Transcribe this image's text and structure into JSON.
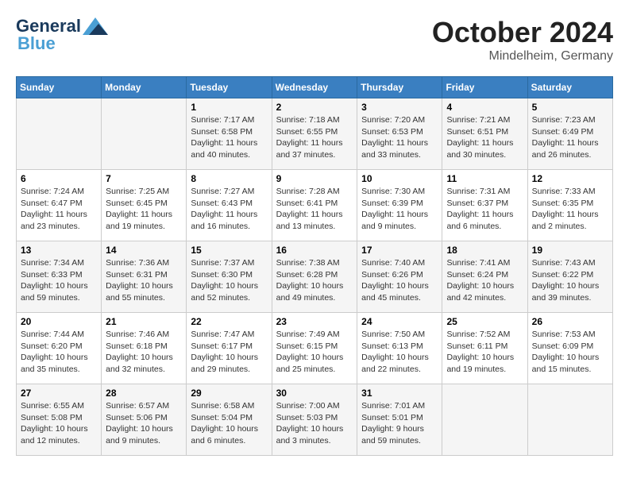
{
  "header": {
    "logo_line1": "General",
    "logo_line2": "Blue",
    "month": "October 2024",
    "location": "Mindelheim, Germany"
  },
  "days_of_week": [
    "Sunday",
    "Monday",
    "Tuesday",
    "Wednesday",
    "Thursday",
    "Friday",
    "Saturday"
  ],
  "weeks": [
    [
      {
        "day": "",
        "sunrise": "",
        "sunset": "",
        "daylight": ""
      },
      {
        "day": "",
        "sunrise": "",
        "sunset": "",
        "daylight": ""
      },
      {
        "day": "1",
        "sunrise": "Sunrise: 7:17 AM",
        "sunset": "Sunset: 6:58 PM",
        "daylight": "Daylight: 11 hours and 40 minutes."
      },
      {
        "day": "2",
        "sunrise": "Sunrise: 7:18 AM",
        "sunset": "Sunset: 6:55 PM",
        "daylight": "Daylight: 11 hours and 37 minutes."
      },
      {
        "day": "3",
        "sunrise": "Sunrise: 7:20 AM",
        "sunset": "Sunset: 6:53 PM",
        "daylight": "Daylight: 11 hours and 33 minutes."
      },
      {
        "day": "4",
        "sunrise": "Sunrise: 7:21 AM",
        "sunset": "Sunset: 6:51 PM",
        "daylight": "Daylight: 11 hours and 30 minutes."
      },
      {
        "day": "5",
        "sunrise": "Sunrise: 7:23 AM",
        "sunset": "Sunset: 6:49 PM",
        "daylight": "Daylight: 11 hours and 26 minutes."
      }
    ],
    [
      {
        "day": "6",
        "sunrise": "Sunrise: 7:24 AM",
        "sunset": "Sunset: 6:47 PM",
        "daylight": "Daylight: 11 hours and 23 minutes."
      },
      {
        "day": "7",
        "sunrise": "Sunrise: 7:25 AM",
        "sunset": "Sunset: 6:45 PM",
        "daylight": "Daylight: 11 hours and 19 minutes."
      },
      {
        "day": "8",
        "sunrise": "Sunrise: 7:27 AM",
        "sunset": "Sunset: 6:43 PM",
        "daylight": "Daylight: 11 hours and 16 minutes."
      },
      {
        "day": "9",
        "sunrise": "Sunrise: 7:28 AM",
        "sunset": "Sunset: 6:41 PM",
        "daylight": "Daylight: 11 hours and 13 minutes."
      },
      {
        "day": "10",
        "sunrise": "Sunrise: 7:30 AM",
        "sunset": "Sunset: 6:39 PM",
        "daylight": "Daylight: 11 hours and 9 minutes."
      },
      {
        "day": "11",
        "sunrise": "Sunrise: 7:31 AM",
        "sunset": "Sunset: 6:37 PM",
        "daylight": "Daylight: 11 hours and 6 minutes."
      },
      {
        "day": "12",
        "sunrise": "Sunrise: 7:33 AM",
        "sunset": "Sunset: 6:35 PM",
        "daylight": "Daylight: 11 hours and 2 minutes."
      }
    ],
    [
      {
        "day": "13",
        "sunrise": "Sunrise: 7:34 AM",
        "sunset": "Sunset: 6:33 PM",
        "daylight": "Daylight: 10 hours and 59 minutes."
      },
      {
        "day": "14",
        "sunrise": "Sunrise: 7:36 AM",
        "sunset": "Sunset: 6:31 PM",
        "daylight": "Daylight: 10 hours and 55 minutes."
      },
      {
        "day": "15",
        "sunrise": "Sunrise: 7:37 AM",
        "sunset": "Sunset: 6:30 PM",
        "daylight": "Daylight: 10 hours and 52 minutes."
      },
      {
        "day": "16",
        "sunrise": "Sunrise: 7:38 AM",
        "sunset": "Sunset: 6:28 PM",
        "daylight": "Daylight: 10 hours and 49 minutes."
      },
      {
        "day": "17",
        "sunrise": "Sunrise: 7:40 AM",
        "sunset": "Sunset: 6:26 PM",
        "daylight": "Daylight: 10 hours and 45 minutes."
      },
      {
        "day": "18",
        "sunrise": "Sunrise: 7:41 AM",
        "sunset": "Sunset: 6:24 PM",
        "daylight": "Daylight: 10 hours and 42 minutes."
      },
      {
        "day": "19",
        "sunrise": "Sunrise: 7:43 AM",
        "sunset": "Sunset: 6:22 PM",
        "daylight": "Daylight: 10 hours and 39 minutes."
      }
    ],
    [
      {
        "day": "20",
        "sunrise": "Sunrise: 7:44 AM",
        "sunset": "Sunset: 6:20 PM",
        "daylight": "Daylight: 10 hours and 35 minutes."
      },
      {
        "day": "21",
        "sunrise": "Sunrise: 7:46 AM",
        "sunset": "Sunset: 6:18 PM",
        "daylight": "Daylight: 10 hours and 32 minutes."
      },
      {
        "day": "22",
        "sunrise": "Sunrise: 7:47 AM",
        "sunset": "Sunset: 6:17 PM",
        "daylight": "Daylight: 10 hours and 29 minutes."
      },
      {
        "day": "23",
        "sunrise": "Sunrise: 7:49 AM",
        "sunset": "Sunset: 6:15 PM",
        "daylight": "Daylight: 10 hours and 25 minutes."
      },
      {
        "day": "24",
        "sunrise": "Sunrise: 7:50 AM",
        "sunset": "Sunset: 6:13 PM",
        "daylight": "Daylight: 10 hours and 22 minutes."
      },
      {
        "day": "25",
        "sunrise": "Sunrise: 7:52 AM",
        "sunset": "Sunset: 6:11 PM",
        "daylight": "Daylight: 10 hours and 19 minutes."
      },
      {
        "day": "26",
        "sunrise": "Sunrise: 7:53 AM",
        "sunset": "Sunset: 6:09 PM",
        "daylight": "Daylight: 10 hours and 15 minutes."
      }
    ],
    [
      {
        "day": "27",
        "sunrise": "Sunrise: 6:55 AM",
        "sunset": "Sunset: 5:08 PM",
        "daylight": "Daylight: 10 hours and 12 minutes."
      },
      {
        "day": "28",
        "sunrise": "Sunrise: 6:57 AM",
        "sunset": "Sunset: 5:06 PM",
        "daylight": "Daylight: 10 hours and 9 minutes."
      },
      {
        "day": "29",
        "sunrise": "Sunrise: 6:58 AM",
        "sunset": "Sunset: 5:04 PM",
        "daylight": "Daylight: 10 hours and 6 minutes."
      },
      {
        "day": "30",
        "sunrise": "Sunrise: 7:00 AM",
        "sunset": "Sunset: 5:03 PM",
        "daylight": "Daylight: 10 hours and 3 minutes."
      },
      {
        "day": "31",
        "sunrise": "Sunrise: 7:01 AM",
        "sunset": "Sunset: 5:01 PM",
        "daylight": "Daylight: 9 hours and 59 minutes."
      },
      {
        "day": "",
        "sunrise": "",
        "sunset": "",
        "daylight": ""
      },
      {
        "day": "",
        "sunrise": "",
        "sunset": "",
        "daylight": ""
      }
    ]
  ]
}
